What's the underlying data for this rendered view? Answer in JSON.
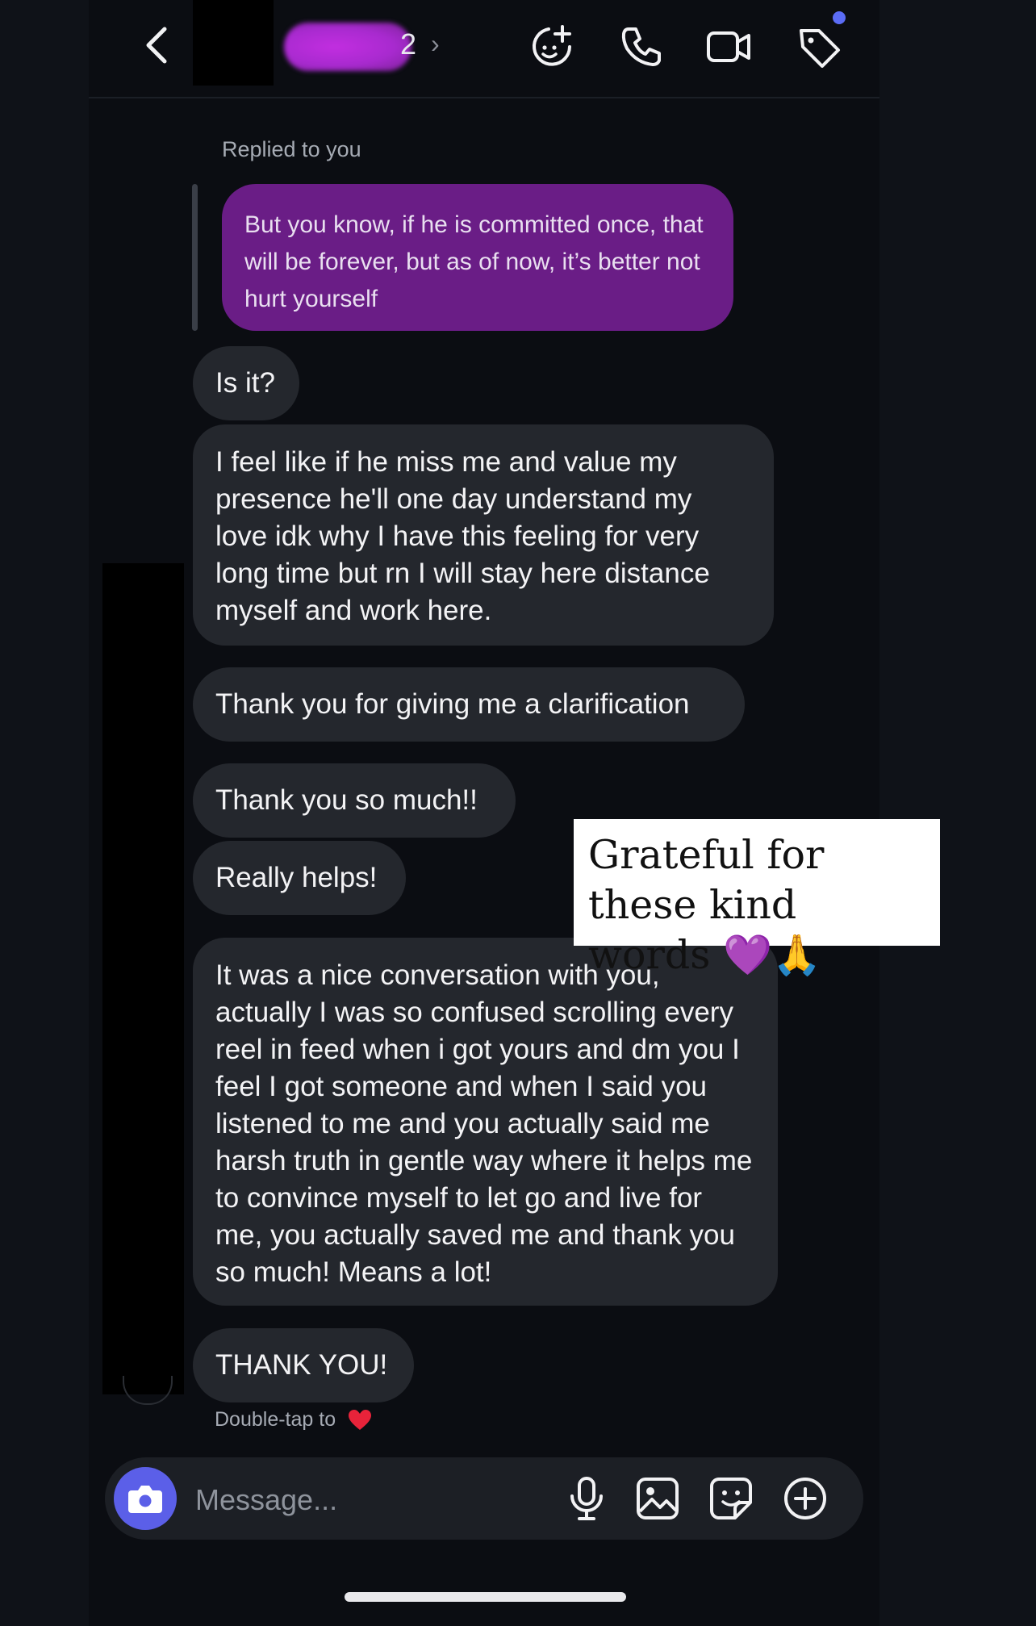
{
  "header": {
    "contact_name_visible_suffix": "2",
    "contact_chevron": "›",
    "icons": [
      "back-icon",
      "ai-sparkle-icon",
      "phone-icon",
      "video-icon",
      "tag-icon"
    ],
    "accent_dot_color": "#5b6cf5"
  },
  "conversation": {
    "replied_label": "Replied to you",
    "replied_message": "But you know, if he is committed once, that will be forever, but as of now, it’s better not hurt yourself",
    "messages": [
      {
        "text": "Is it?"
      },
      {
        "text": "I feel like if he miss me and value my presence he'll one day understand my love idk why I have this feeling for very long time but rn I will stay here distance myself and work here."
      },
      {
        "text": "Thank you for giving me a clarification"
      },
      {
        "text": "Thank you so much!!"
      },
      {
        "text": "Really helps!"
      },
      {
        "text": "It was a nice conversation with you, actually I was so confused scrolling every reel in feed when i got yours and dm you I feel I got someone and when I said you listened to me and you actually said me harsh truth in gentle way where it helps me to convince myself to let go and live for me, you actually saved me and thank you so much! Means a lot!"
      },
      {
        "text": "THANK YOU!"
      }
    ],
    "double_tap_hint": "Double-tap to"
  },
  "overlay": {
    "caption": "Grateful for these kind words 💜🙏"
  },
  "composer": {
    "placeholder": "Message...",
    "icons": [
      "camera-icon",
      "microphone-icon",
      "gallery-icon",
      "sticker-icon",
      "plus-icon"
    ]
  },
  "colors": {
    "background": "#0b0d12",
    "incoming_bubble": "#24272d",
    "replied_bubble": "#6a1d86",
    "camera_button": "#5b5fe8"
  }
}
